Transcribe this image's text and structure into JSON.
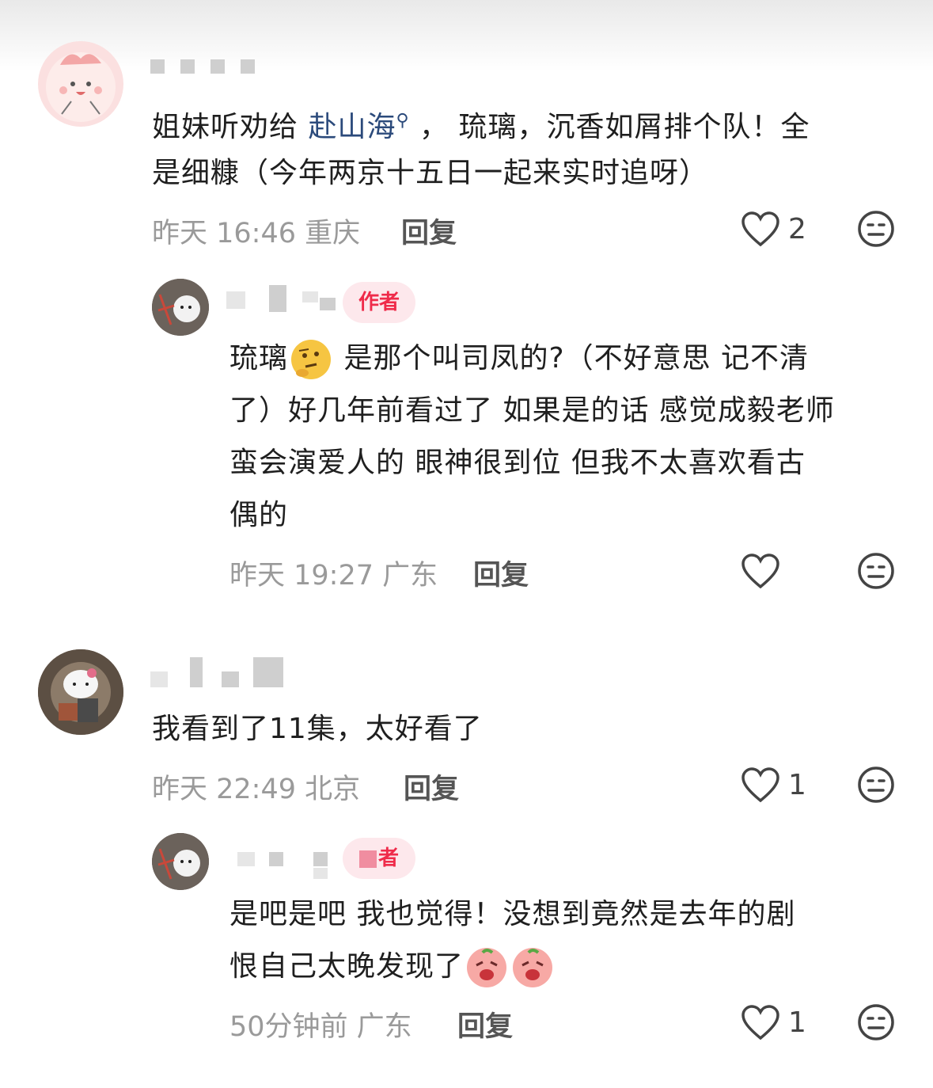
{
  "comments": [
    {
      "content_before_link": "姐妹听劝给 ",
      "link_text": "赴山海",
      "content_after_link": " ， 琉璃，沉香如屑排个队！全",
      "content_line2": "是细糠（今年两京十五日一起来实时追呀）",
      "time": "昨天 16:46 重庆",
      "reply_label": "回复",
      "likes": "2",
      "reply": {
        "badge": "作者",
        "line1_before_emoji": "琉璃",
        "line1_after_emoji": " 是那个叫司凤的?（不好意思 记不清",
        "line2": "了）好几年前看过了 如果是的话 感觉成毅老师",
        "line3": "蛮会演爱人的 眼神很到位 但我不太喜欢看古",
        "line4": "偶的",
        "time": "昨天 19:27 广东",
        "reply_label": "回复"
      }
    },
    {
      "content": "我看到了11集，太好看了",
      "time": "昨天 22:49 北京",
      "reply_label": "回复",
      "likes": "1",
      "reply": {
        "badge": "者",
        "line1": "是吧是吧 我也觉得！没想到竟然是去年的剧",
        "line2": "恨自己太晚发现了",
        "time": "50分钟前 广东",
        "reply_label": "回复",
        "likes": "1"
      }
    }
  ]
}
